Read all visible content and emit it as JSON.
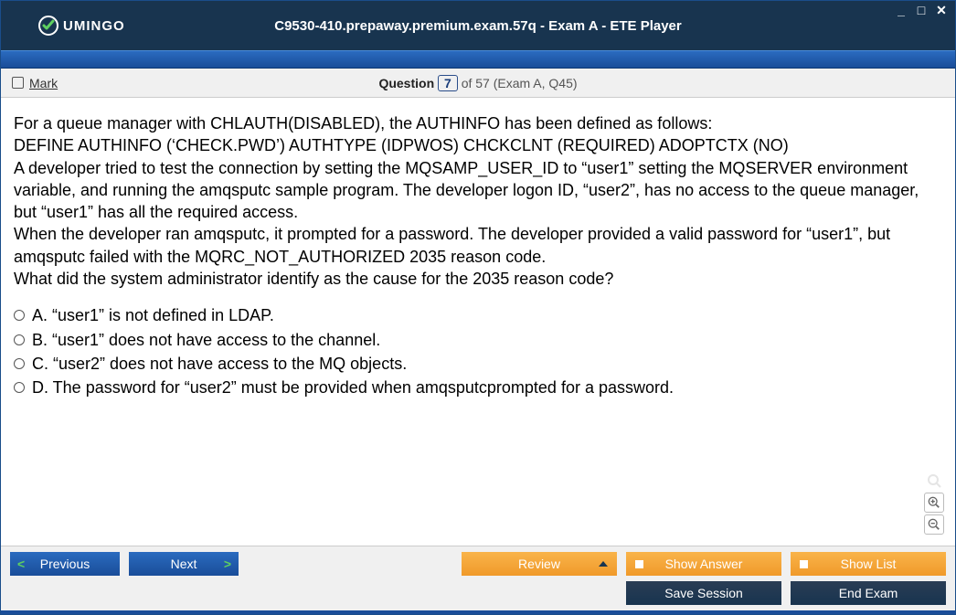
{
  "titlebar": {
    "logo_text": "UMINGO",
    "title": "C9530-410.prepaway.premium.exam.57q - Exam A - ETE Player"
  },
  "question_bar": {
    "mark_label": "Mark",
    "question_word": "Question",
    "number": "7",
    "rest": "of 57 (Exam A, Q45)"
  },
  "question": {
    "text": "For a queue manager with CHLAUTH(DISABLED), the AUTHINFO has been defined as follows:\nDEFINE AUTHINFO (‘CHECK.PWD’) AUTHTYPE (IDPWOS) CHCKCLNT (REQUIRED) ADOPTCTX (NO)\nA developer tried to test the connection by setting the MQSAMP_USER_ID to “user1” setting the MQSERVER environment variable, and running the amqsputc sample program. The developer logon ID, “user2”, has no access to the queue manager, but “user1” has all the required access.\nWhen the developer ran amqsputc, it prompted for a password. The developer provided a valid password for “user1”, but amqsputc  failed with the MQRC_NOT_AUTHORIZED 2035 reason code.\nWhat did the system administrator identify as the cause for the 2035 reason code?",
    "answers": [
      {
        "letter": "A.",
        "text": "“user1” is not defined in LDAP."
      },
      {
        "letter": "B.",
        "text": "“user1” does not have access to the channel."
      },
      {
        "letter": "C.",
        "text": "“user2” does not have access to the MQ objects."
      },
      {
        "letter": "D.",
        "text": "The password for “user2” must be provided when amqsputcprompted for a password."
      }
    ]
  },
  "footer": {
    "previous": "Previous",
    "next": "Next",
    "review": "Review",
    "show_answer": "Show Answer",
    "show_list": "Show List",
    "save_session": "Save Session",
    "end_exam": "End Exam"
  }
}
